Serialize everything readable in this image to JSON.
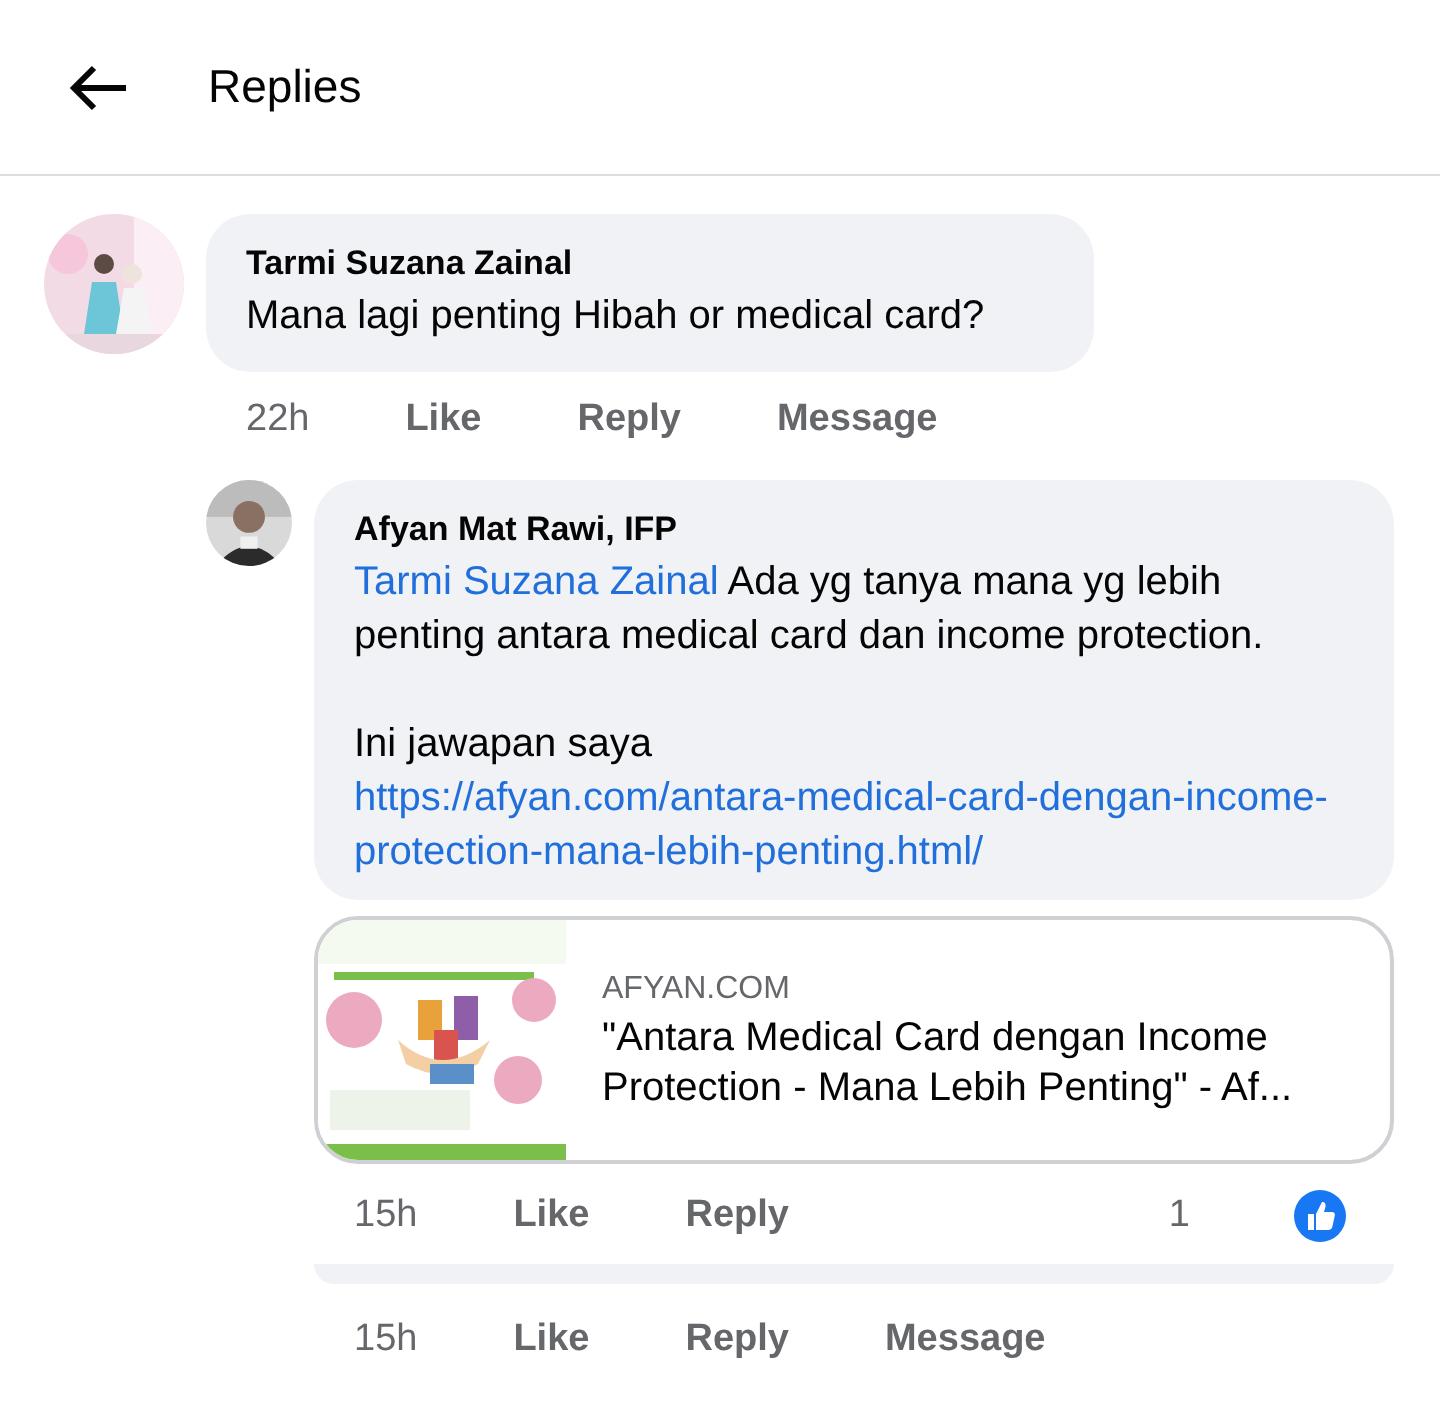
{
  "header": {
    "title": "Replies"
  },
  "comments": [
    {
      "author": "Tarmi Suzana Zainal",
      "text": "Mana lagi penting Hibah or medical card?",
      "time": "22h",
      "actions": [
        "Like",
        "Reply",
        "Message"
      ],
      "replies": [
        {
          "author": "Afyan Mat Rawi, IFP",
          "mention": "Tarmi Suzana Zainal",
          "text": "Ada yg tanya mana yg lebih penting antara medical card dan income protection.",
          "text_2": "Ini jawapan saya",
          "link": "https://afyan.com/antara-medical-card-dengan-income-protection-mana-lebih-penting.html/",
          "preview": {
            "domain": "AFYAN.COM",
            "title": "\"Antara Medical Card dengan Income Protection - Mana Lebih Penting\" - Af..."
          },
          "time": "15h",
          "actions": [
            "Like",
            "Reply"
          ],
          "reaction_count": "1"
        },
        {
          "time": "15h",
          "actions": [
            "Like",
            "Reply",
            "Message"
          ]
        }
      ]
    }
  ]
}
